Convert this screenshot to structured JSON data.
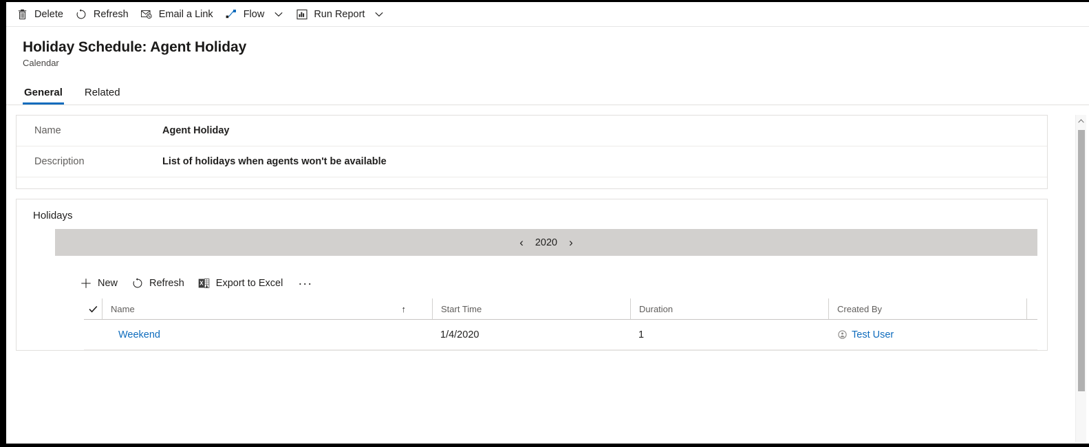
{
  "commandbar": {
    "items": [
      {
        "label": "Delete",
        "icon": "trash-icon",
        "caret": false
      },
      {
        "label": "Refresh",
        "icon": "refresh-icon",
        "caret": false
      },
      {
        "label": "Email a Link",
        "icon": "email-link-icon",
        "caret": false
      },
      {
        "label": "Flow",
        "icon": "flow-icon",
        "caret": true
      },
      {
        "label": "Run Report",
        "icon": "report-icon",
        "caret": true
      }
    ]
  },
  "header": {
    "title": "Holiday Schedule: Agent Holiday",
    "subtitle": "Calendar",
    "tabs": [
      {
        "label": "General",
        "selected": true
      },
      {
        "label": "Related",
        "selected": false
      }
    ]
  },
  "general": {
    "fields": [
      {
        "label": "Name",
        "value": "Agent Holiday"
      },
      {
        "label": "Description",
        "value": "List of holidays when agents won't be available"
      }
    ]
  },
  "holidays": {
    "section_title": "Holidays",
    "year_nav": {
      "prev_label": "‹",
      "year": "2020",
      "next_label": "›"
    },
    "commands": [
      {
        "label": "New",
        "icon": "add-icon"
      },
      {
        "label": "Refresh",
        "icon": "refresh-icon"
      },
      {
        "label": "Export to Excel",
        "icon": "excel-icon"
      },
      {
        "label": "···",
        "icon": "overflow-icon"
      }
    ],
    "grid": {
      "select_all_icon": "checkmark-icon",
      "sort_indicator": "↑",
      "columns": [
        {
          "label": "Name",
          "sorted": true
        },
        {
          "label": "Start Time",
          "sorted": false
        },
        {
          "label": "Duration",
          "sorted": false
        },
        {
          "label": "Created By",
          "sorted": false
        }
      ],
      "rows": [
        {
          "name": "Weekend",
          "start_time": "1/4/2020",
          "duration": "1",
          "created_by": "Test User",
          "created_by_icon": "user-circle-icon"
        }
      ]
    }
  },
  "colors": {
    "accent": "#0f6cbd",
    "link": "#0f6cbd",
    "year_bar_bg": "#d2d0ce",
    "text": "#201f1e",
    "muted_text": "#605e5c"
  }
}
